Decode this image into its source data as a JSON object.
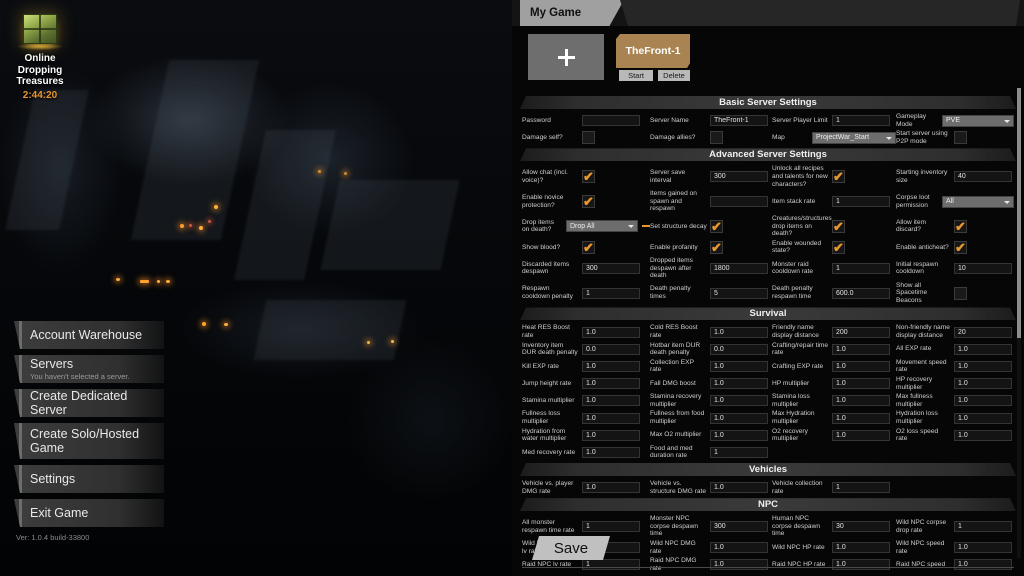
{
  "hud": {
    "icon": "treasure-crate-icon",
    "title_line1": "Online",
    "title_line2": "Dropping",
    "title_line3": "Treasures",
    "timer": "2:44:20",
    "timer_color": "#e8962e"
  },
  "menu": {
    "items": [
      {
        "label": "Account Warehouse",
        "sub": ""
      },
      {
        "label": "Servers",
        "sub": "You haven't selected a server."
      },
      {
        "label": "Create Dedicated Server",
        "sub": ""
      },
      {
        "label": "Create Solo/Hosted Game",
        "sub": ""
      },
      {
        "label": "Settings",
        "sub": ""
      },
      {
        "label": "Exit Game",
        "sub": ""
      }
    ],
    "version": "Ver: 1.0.4 build-33800"
  },
  "panel": {
    "tab": "My Game",
    "add_server": "+",
    "server_card": "TheFront-1",
    "start": "Start",
    "delete": "Delete",
    "save": "Save"
  },
  "sections": {
    "basic": "Basic Server Settings",
    "advanced": "Advanced Server Settings",
    "survival": "Survival",
    "vehicles": "Vehicles",
    "npc": "NPC"
  },
  "basic_rows": [
    [
      {
        "label": "Password",
        "type": "text",
        "value": "",
        "placeholder": ""
      },
      {
        "label": "Server Name",
        "type": "text",
        "value": "TheFront-1",
        "placeholder": ""
      },
      {
        "label": "Server Player Limit",
        "type": "text",
        "value": "1",
        "placeholder": ""
      },
      {
        "label": "Gameplay Mode",
        "type": "dropdown",
        "value": "PVE"
      }
    ],
    [
      {
        "label": "Damage self?",
        "type": "check",
        "value": false
      },
      {
        "label": "Damage allies?",
        "type": "check",
        "value": false
      },
      {
        "label": "Map",
        "type": "dropdown",
        "value": "ProjectWar_Start"
      },
      {
        "label": "Start server using P2P mode",
        "type": "check",
        "value": false
      }
    ]
  ],
  "advanced_rows": [
    [
      {
        "label": "Allow chat (incl. voice)?",
        "type": "check",
        "value": true
      },
      {
        "label": "Server save interval",
        "type": "text",
        "value": "300"
      },
      {
        "label": "Unlock all recipes and talents for new characters?",
        "type": "check",
        "value": true
      },
      {
        "label": "Starting inventory size",
        "type": "text",
        "value": "40"
      }
    ],
    [
      {
        "label": "Enable novice protection?",
        "type": "check",
        "value": true
      },
      {
        "label": "Items gained on spawn and respawn",
        "type": "text",
        "value": ""
      },
      {
        "label": "Item stack rate",
        "type": "text",
        "value": "1"
      },
      {
        "label": "Corpse loot permission",
        "type": "dropdown",
        "value": "All"
      }
    ],
    [
      {
        "label": "Drop items on death?",
        "type": "dropdown",
        "value": "Drop All"
      },
      {
        "label": "Set structure decay",
        "type": "check",
        "value": true
      },
      {
        "label": "Creatures/structures drop items on death?",
        "type": "check",
        "value": true
      },
      {
        "label": "Allow item discard?",
        "type": "check",
        "value": true
      }
    ],
    [
      {
        "label": "Show blood?",
        "type": "check",
        "value": true
      },
      {
        "label": "Enable profanity",
        "type": "check",
        "value": true
      },
      {
        "label": "Enable wounded state?",
        "type": "check",
        "value": true
      },
      {
        "label": "Enable anticheat?",
        "type": "check",
        "value": true
      }
    ],
    [
      {
        "label": "Discarded items despawn",
        "type": "text",
        "value": "300"
      },
      {
        "label": "Dropped items despawn after death",
        "type": "text",
        "value": "1800"
      },
      {
        "label": "Monster raid cooldown rate",
        "type": "text",
        "value": "1"
      },
      {
        "label": "Initial respawn cooldown",
        "type": "text",
        "value": "10"
      }
    ],
    [
      {
        "label": "Respawn cooldown penalty",
        "type": "text",
        "value": "1"
      },
      {
        "label": "Death penalty times",
        "type": "text",
        "value": "5"
      },
      {
        "label": "Death penalty respawn time",
        "type": "text",
        "value": "600.0"
      },
      {
        "label": "Show all Spacetime Beacons",
        "type": "check",
        "value": false
      }
    ]
  ],
  "survival_rows": [
    [
      {
        "label": "Heat RES Boost rate",
        "type": "text",
        "value": "1.0"
      },
      {
        "label": "Cold RES Boost rate",
        "type": "text",
        "value": "1.0"
      },
      {
        "label": "Friendly name display distance",
        "type": "text",
        "value": "200"
      },
      {
        "label": "Non-friendly name display distance",
        "type": "text",
        "value": "20"
      }
    ],
    [
      {
        "label": "Inventory item DUR death penalty",
        "type": "text",
        "value": "0.0"
      },
      {
        "label": "Hotbar item DUR death penalty",
        "type": "text",
        "value": "0.0"
      },
      {
        "label": "Crafting/repair time rate",
        "type": "text",
        "value": "1.0"
      },
      {
        "label": "All EXP rate",
        "type": "text",
        "value": "1.0"
      }
    ],
    [
      {
        "label": "Kill EXP rate",
        "type": "text",
        "value": "1.0"
      },
      {
        "label": "Collection EXP rate",
        "type": "text",
        "value": "1.0"
      },
      {
        "label": "Crafting EXP rate",
        "type": "text",
        "value": "1.0"
      },
      {
        "label": "Movement speed rate",
        "type": "text",
        "value": "1.0"
      }
    ],
    [
      {
        "label": "Jump height rate",
        "type": "text",
        "value": "1.0"
      },
      {
        "label": "Fall DMG boost",
        "type": "text",
        "value": "1.0"
      },
      {
        "label": "HP multiplier",
        "type": "text",
        "value": "1.0"
      },
      {
        "label": "HP recovery multiplier",
        "type": "text",
        "value": "1.0"
      }
    ],
    [
      {
        "label": "Stamina multiplier",
        "type": "text",
        "value": "1.0"
      },
      {
        "label": "Stamina recovery multiplier",
        "type": "text",
        "value": "1.0"
      },
      {
        "label": "Stamina loss multiplier",
        "type": "text",
        "value": "1.0"
      },
      {
        "label": "Max fullness multiplier",
        "type": "text",
        "value": "1.0"
      }
    ],
    [
      {
        "label": "Fullness loss multiplier",
        "type": "text",
        "value": "1.0"
      },
      {
        "label": "Fullness from food multiplier",
        "type": "text",
        "value": "1.0"
      },
      {
        "label": "Max Hydration multiplier",
        "type": "text",
        "value": "1.0"
      },
      {
        "label": "Hydration loss multiplier",
        "type": "text",
        "value": "1.0"
      }
    ],
    [
      {
        "label": "Hydration from water multiplier",
        "type": "text",
        "value": "1.0"
      },
      {
        "label": "Max O2 multiplier",
        "type": "text",
        "value": "1.0"
      },
      {
        "label": "O2 recovery multiplier",
        "type": "text",
        "value": "1.0"
      },
      {
        "label": "O2 loss speed rate",
        "type": "text",
        "value": "1.0"
      }
    ],
    [
      {
        "label": "Med recovery rate",
        "type": "text",
        "value": "1.0"
      },
      {
        "label": "Food and med duration rate",
        "type": "text",
        "value": "1"
      },
      {
        "label": "",
        "type": "none",
        "value": ""
      },
      {
        "label": "",
        "type": "none",
        "value": ""
      }
    ]
  ],
  "vehicles_rows": [
    [
      {
        "label": "Vehicle vs. player DMG rate",
        "type": "text",
        "value": "1.0"
      },
      {
        "label": "Vehicle vs. structure DMG rate",
        "type": "text",
        "value": "1.0"
      },
      {
        "label": "Vehicle collection rate",
        "type": "text",
        "value": "1"
      },
      {
        "label": "",
        "type": "none",
        "value": ""
      }
    ]
  ],
  "npc_rows": [
    [
      {
        "label": "All monster respawn time rate",
        "type": "text",
        "value": "1"
      },
      {
        "label": "Monster NPC corpse despawn time",
        "type": "text",
        "value": "300"
      },
      {
        "label": "Human NPC corpse despawn time",
        "type": "text",
        "value": "30"
      },
      {
        "label": "Wild NPC corpse drop rate",
        "type": "text",
        "value": "1"
      }
    ],
    [
      {
        "label": "Wild NPC starting lv rate",
        "type": "text",
        "value": "1"
      },
      {
        "label": "Wild NPC DMG rate",
        "type": "text",
        "value": "1.0"
      },
      {
        "label": "Wild NPC HP rate",
        "type": "text",
        "value": "1.0"
      },
      {
        "label": "Wild NPC speed rate",
        "type": "text",
        "value": "1.0"
      }
    ],
    [
      {
        "label": "Raid NPC lv rate",
        "type": "text",
        "value": "1"
      },
      {
        "label": "Raid NPC DMG rate",
        "type": "text",
        "value": "1.0"
      },
      {
        "label": "Raid NPC HP rate",
        "type": "text",
        "value": "1.0"
      },
      {
        "label": "Raid NPC speed",
        "type": "text",
        "value": "1.0"
      }
    ]
  ]
}
